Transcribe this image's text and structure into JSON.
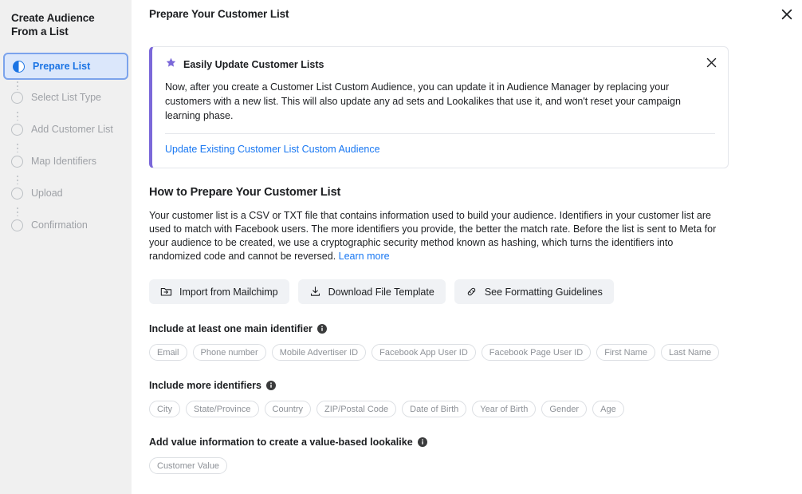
{
  "sidebar": {
    "title": "Create Audience From a List",
    "steps": [
      {
        "label": "Prepare List",
        "state": "active"
      },
      {
        "label": "Select List Type",
        "state": "inactive"
      },
      {
        "label": "Add Customer List",
        "state": "inactive"
      },
      {
        "label": "Map Identifiers",
        "state": "inactive"
      },
      {
        "label": "Upload",
        "state": "inactive"
      },
      {
        "label": "Confirmation",
        "state": "inactive"
      }
    ]
  },
  "header": {
    "title": "Prepare Your Customer List",
    "close_icon": "close-icon"
  },
  "banner": {
    "icon": "star-icon",
    "title": "Easily Update Customer Lists",
    "body": "Now, after you create a Customer List Custom Audience, you can update it in Audience Manager by replacing your customers with a new list. This will also update any ad sets and Lookalikes that use it, and won't reset your campaign learning phase.",
    "link": "Update Existing Customer List Custom Audience",
    "close_icon": "close-icon",
    "accent_color": "#7b68d9",
    "link_color": "#1877f2"
  },
  "section": {
    "title": "How to Prepare Your Customer List",
    "paragraph": "Your customer list is a CSV or TXT file that contains information used to build your audience. Identifiers in your customer list are used to match with Facebook users. The more identifiers you provide, the better the match rate. Before the list is sent to Meta for your audience to be created, we use a cryptographic security method known as hashing, which turns the identifiers into randomized code and cannot be reversed. ",
    "learn_more": "Learn more"
  },
  "buttons": [
    {
      "label": "Import from Mailchimp",
      "icon": "folder-import-icon"
    },
    {
      "label": "Download File Template",
      "icon": "download-icon"
    },
    {
      "label": "See Formatting Guidelines",
      "icon": "link-chain-icon"
    }
  ],
  "groups": [
    {
      "label": "Include at least one main identifier",
      "info_icon": "info-icon",
      "pills": [
        "Email",
        "Phone number",
        "Mobile Advertiser ID",
        "Facebook App User ID",
        "Facebook Page User ID",
        "First Name",
        "Last Name"
      ]
    },
    {
      "label": "Include more identifiers",
      "info_icon": "info-icon",
      "pills": [
        "City",
        "State/Province",
        "Country",
        "ZIP/Postal Code",
        "Date of Birth",
        "Year of Birth",
        "Gender",
        "Age"
      ]
    },
    {
      "label": "Add value information to create a value-based lookalike",
      "info_icon": "info-icon",
      "pills": [
        "Customer Value"
      ]
    }
  ]
}
